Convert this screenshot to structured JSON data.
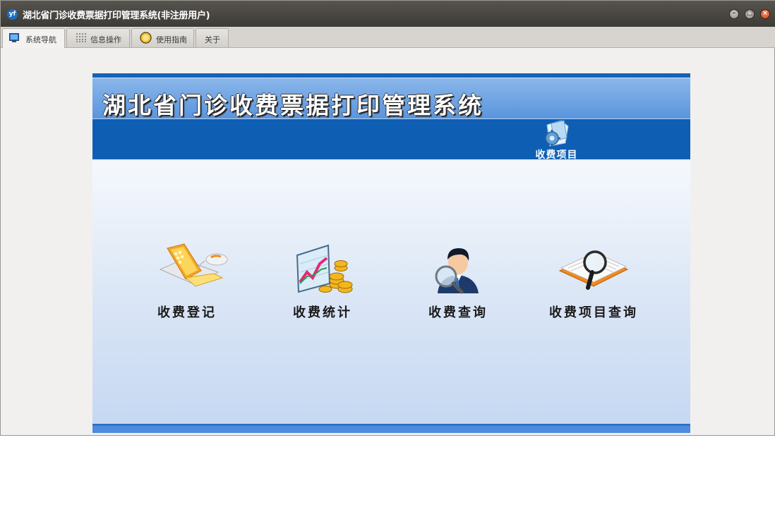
{
  "window": {
    "title": "湖北省门诊收费票据打印管理系统(非注册用户)",
    "app_icon_text": "yf"
  },
  "tabs": [
    {
      "label": "系统导航",
      "icon": "monitor-icon",
      "active": true
    },
    {
      "label": "信息操作",
      "icon": "grid-icon",
      "active": false
    },
    {
      "label": "使用指南",
      "icon": "guide-icon",
      "active": false
    },
    {
      "label": "关于",
      "icon": "",
      "active": false
    }
  ],
  "banner": {
    "title": "湖北省门诊收费票据打印管理系统",
    "nav_item": {
      "label": "收费项目",
      "icon": "folder-gear-icon"
    }
  },
  "features": [
    {
      "label": "收费登记",
      "icon": "laptop-mouse-icon"
    },
    {
      "label": "收费统计",
      "icon": "chart-coins-icon"
    },
    {
      "label": "收费查询",
      "icon": "person-magnifier-icon"
    },
    {
      "label": "收费项目查询",
      "icon": "book-magnifier-icon"
    }
  ],
  "colors": {
    "nav_band": "#0e5fb4",
    "title_band": "#5a95de",
    "titlebar": "#3d3b37"
  }
}
